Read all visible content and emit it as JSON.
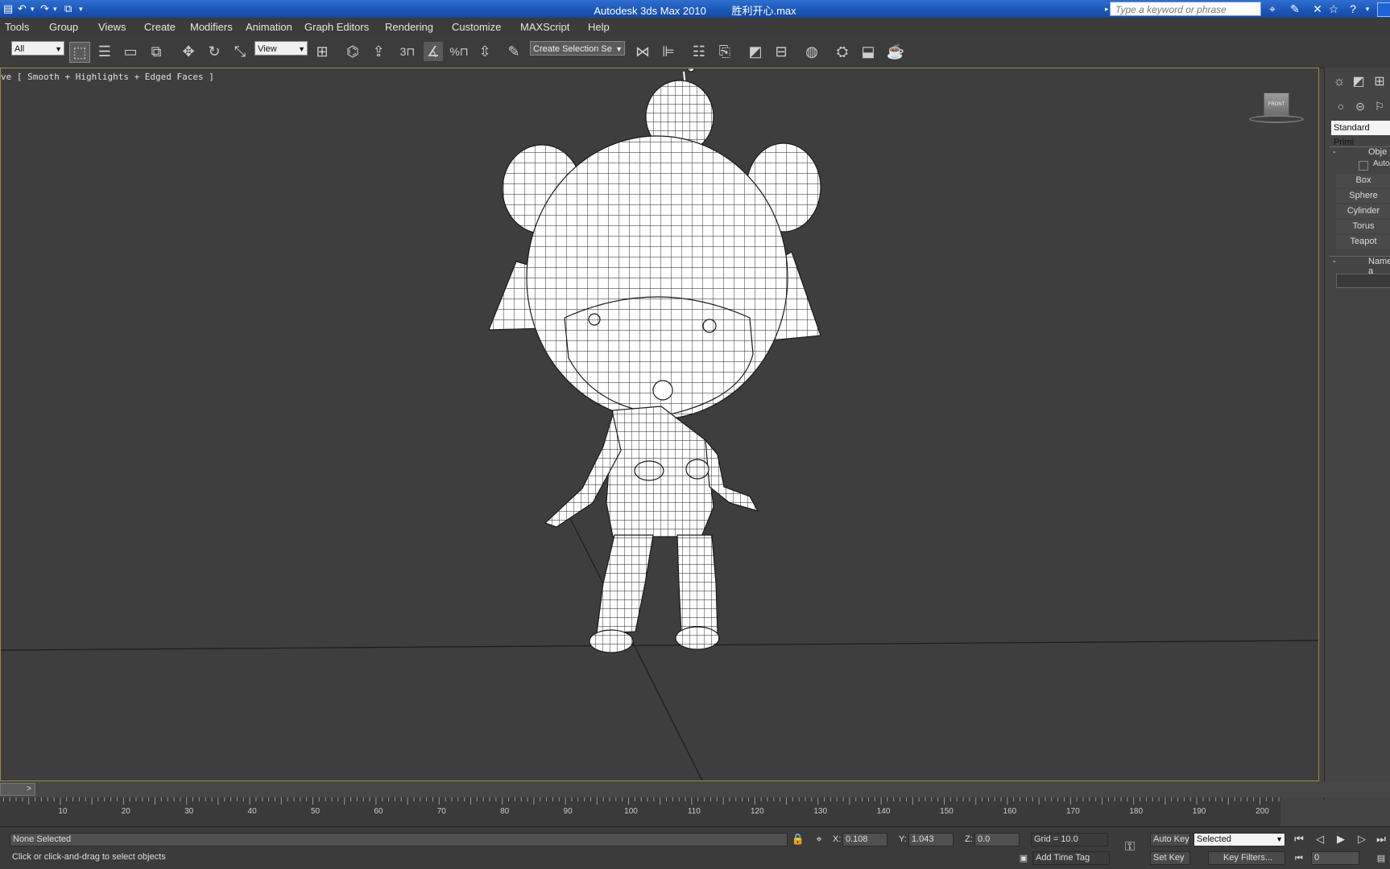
{
  "window": {
    "app_title": "Autodesk 3ds Max  2010",
    "file_name": "胜利开心.max",
    "search_placeholder": "Type a keyword or phrase"
  },
  "menu": [
    "Tools",
    "Group",
    "Views",
    "Create",
    "Modifiers",
    "Animation",
    "Graph Editors",
    "Rendering",
    "Customize",
    "MAXScript",
    "Help"
  ],
  "toolbar": {
    "selection_filter": "All",
    "reference_coord": "View",
    "named_selection": "Create Selection Se"
  },
  "viewport": {
    "label": "ve [ Smooth + Highlights + Edged Faces ]",
    "viewcube": "FRONT"
  },
  "command_panel": {
    "category": "Standard Primi",
    "rollout_object_type": "Obje",
    "autogrid": "Auto",
    "buttons": [
      "Box",
      "Sphere",
      "Cylinder",
      "Torus",
      "Teapot"
    ],
    "rollout_name": "Name a"
  },
  "timeline": {
    "slider_label": ">",
    "ticks": [
      10,
      20,
      30,
      40,
      50,
      60,
      70,
      80,
      90,
      100,
      110,
      120,
      130,
      140,
      150,
      160,
      170,
      180,
      190,
      200
    ]
  },
  "status": {
    "selection": "None Selected",
    "prompt": "Click or click-and-drag to select objects",
    "x_label": "X:",
    "x_value": "0.108",
    "y_label": "Y:",
    "y_value": "1.043",
    "z_label": "Z:",
    "z_value": "0.0",
    "grid": "Grid = 10.0",
    "add_time_tag": "Add Time Tag",
    "auto_key": "Auto Key",
    "set_key": "Set Key",
    "key_mode": "Selected",
    "key_filters": "Key Filters...",
    "frame": "0"
  },
  "colors": {
    "titlebar": "#1a56b8",
    "viewport_bg": "#3e3e3e",
    "viewport_border": "#9b8a3c",
    "mesh_fill": "#ffffff",
    "mesh_wire": "#1a1a1a"
  }
}
